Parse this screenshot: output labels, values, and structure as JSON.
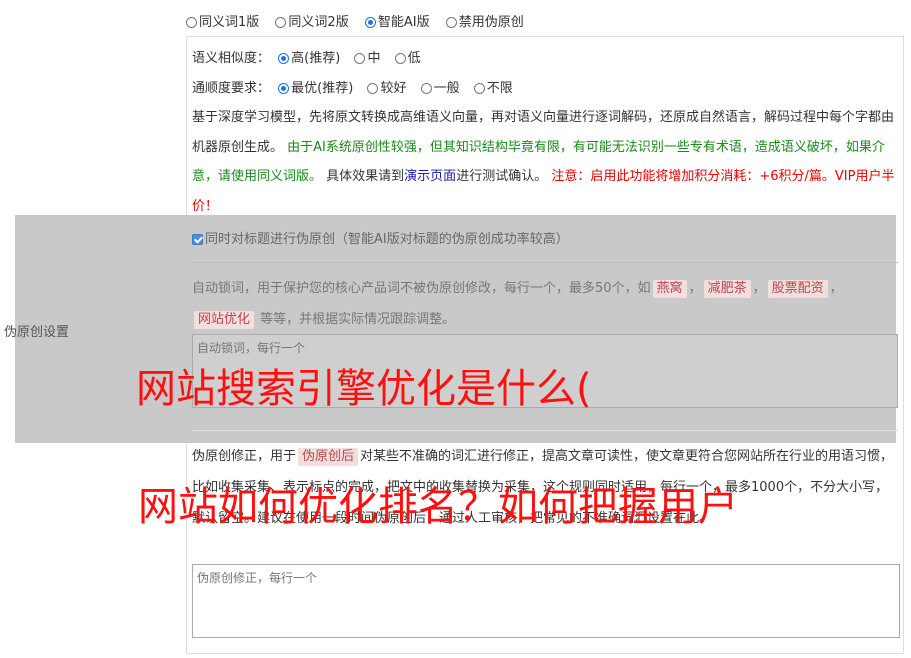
{
  "top_options": [
    {
      "label": "同义词1版",
      "checked": false
    },
    {
      "label": "同义词2版",
      "checked": false
    },
    {
      "label": "智能AI版",
      "checked": true
    },
    {
      "label": "禁用伪原创",
      "checked": false
    }
  ],
  "similarity": {
    "label": "语义相似度：",
    "options": [
      {
        "label": "高(推荐)",
        "checked": true
      },
      {
        "label": "中",
        "checked": false
      },
      {
        "label": "低",
        "checked": false
      }
    ]
  },
  "fluency": {
    "label": "通顺度要求：",
    "options": [
      {
        "label": "最优(推荐)",
        "checked": true
      },
      {
        "label": "较好",
        "checked": false
      },
      {
        "label": "一般",
        "checked": false
      },
      {
        "label": "不限",
        "checked": false
      }
    ]
  },
  "description": {
    "part1": "基于深度学习模型，先将原文转换成高维语义向量，再对语义向量进行逐词解码，还原成自然语言，解码过程中每个字都由机器原创生成。",
    "part2_green": "由于AI系统原创性较强，但其知识结构毕竟有限，有可能无法识别一些专有术语，造成语义破坏，如果介意，请使用同义词版。",
    "part3": "具体效果请到",
    "link": "演示页面",
    "part4": "进行测试确认。",
    "warning": "注意：启用此功能将增加积分消耗：+6积分/篇。VIP用户半价！"
  },
  "side_label": "伪原创设置",
  "title_checkbox": {
    "label": "同时对标题进行伪原创（智能AI版对标题的伪原创成功率较高）",
    "checked": true
  },
  "lock": {
    "desc_before": "自动锁词，用于保护您的核心产品词不被伪原创修改，每行一个，最多50个，如",
    "tags": [
      "燕窝",
      "减肥茶",
      "股票配资",
      "网站优化"
    ],
    "desc_after": "等等，并根据实际情况跟踪调整。",
    "placeholder": "自动锁词，每行一个"
  },
  "fix": {
    "desc_before": "伪原创修正，用于",
    "tag": "伪原创后",
    "desc_after": "对某些不准确的词汇进行修正，提高文章可读性，使文章更符合您网站所在行业的用语习惯，比如收集采集、表示标点的完成，把文中的收集替换为采集，这个规则同时适用，每行一个，最多1000个，不分大小写，默认留空。建议在使用一段时间伪原创后，通过人工审核，把常见的不准确词汇设置在此。",
    "placeholder": "伪原创修正，每行一个"
  },
  "watermarks": [
    "网站搜索引擎优化是什么(",
    "网站如何优化排名？如何把握用户"
  ]
}
